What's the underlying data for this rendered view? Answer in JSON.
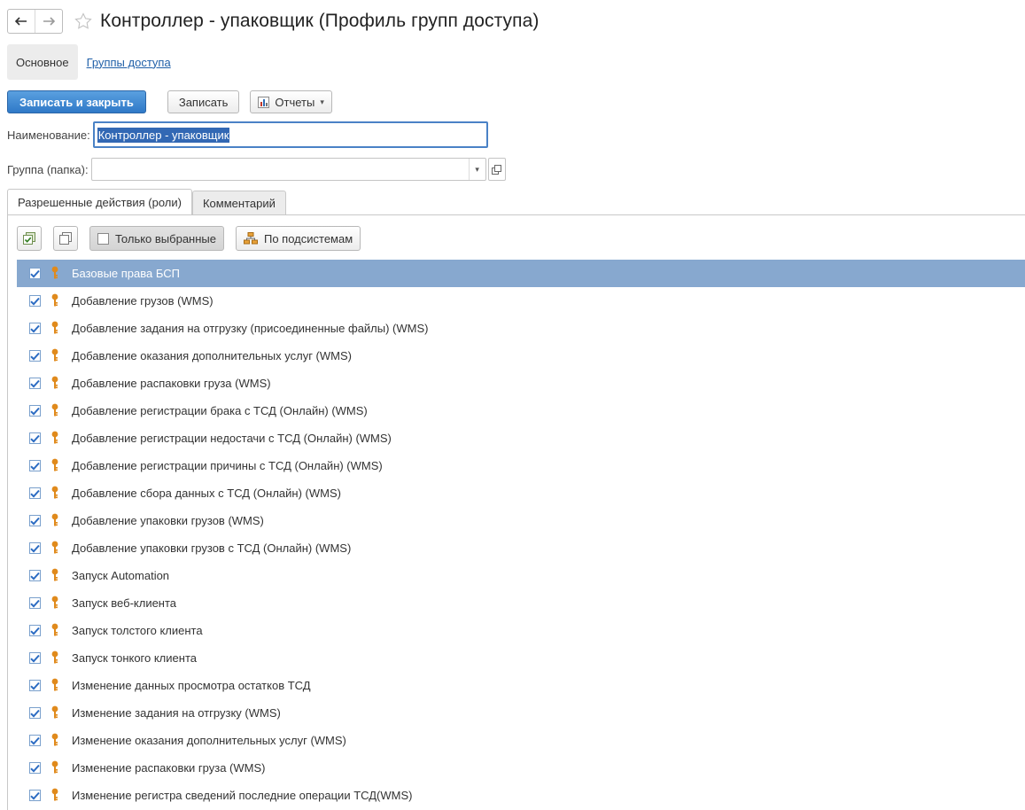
{
  "window": {
    "title": "Контроллер - упаковщик (Профиль групп доступа)",
    "back_icon": "arrow-left",
    "forward_icon": "arrow-right",
    "favorite_icon": "star-outline"
  },
  "sections": [
    {
      "label": "Основное"
    },
    {
      "label": "Группы доступа"
    }
  ],
  "toolbar": {
    "save_close_label": "Записать и закрыть",
    "save_label": "Записать",
    "reports_label": "Отчеты"
  },
  "form": {
    "name_label": "Наименование:",
    "name_value": "Контроллер - упаковщик",
    "group_label": "Группа (папка):",
    "group_value": ""
  },
  "tabs": [
    {
      "label": "Разрешенные действия (роли)"
    },
    {
      "label": "Комментарий"
    }
  ],
  "grid_toolbar": {
    "only_selected_label": "Только выбранные",
    "by_subsystems_label": "По подсистемам"
  },
  "colors": {
    "accent": "#2f79c8",
    "selected_row": "#87a8cf",
    "link": "#1f5fa8",
    "key_icon": "#e08a1c"
  },
  "roles": [
    {
      "label": "Базовые права БСП",
      "checked": true
    },
    {
      "label": "Добавление грузов (WMS)",
      "checked": true
    },
    {
      "label": "Добавление задания на отгрузку (присоединенные файлы) (WMS)",
      "checked": true
    },
    {
      "label": "Добавление оказания дополнительных услуг (WMS)",
      "checked": true
    },
    {
      "label": "Добавление распаковки груза (WMS)",
      "checked": true
    },
    {
      "label": "Добавление регистрации брака с ТСД (Онлайн) (WMS)",
      "checked": true
    },
    {
      "label": "Добавление регистрации недостачи с ТСД (Онлайн) (WMS)",
      "checked": true
    },
    {
      "label": "Добавление регистрации причины с ТСД (Онлайн) (WMS)",
      "checked": true
    },
    {
      "label": "Добавление сбора данных с ТСД (Онлайн) (WMS)",
      "checked": true
    },
    {
      "label": "Добавление упаковки грузов (WMS)",
      "checked": true
    },
    {
      "label": "Добавление упаковки грузов с ТСД (Онлайн) (WMS)",
      "checked": true
    },
    {
      "label": "Запуск Automation",
      "checked": true
    },
    {
      "label": "Запуск веб-клиента",
      "checked": true
    },
    {
      "label": "Запуск толстого клиента",
      "checked": true
    },
    {
      "label": "Запуск тонкого клиента",
      "checked": true
    },
    {
      "label": "Изменение данных просмотра остатков ТСД",
      "checked": true
    },
    {
      "label": "Изменение задания на отгрузку (WMS)",
      "checked": true
    },
    {
      "label": "Изменение оказания дополнительных услуг (WMS)",
      "checked": true
    },
    {
      "label": "Изменение распаковки груза (WMS)",
      "checked": true
    },
    {
      "label": "Изменение регистра сведений последние операции ТСД(WMS)",
      "checked": true
    }
  ]
}
